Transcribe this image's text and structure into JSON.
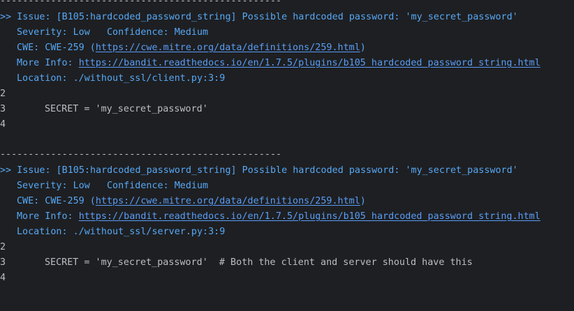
{
  "colors": {
    "background": "#1e1f22",
    "text": "#bcbec4",
    "accent": "#56a8f5",
    "link": "#589df6"
  },
  "blocks": [
    {
      "separator": "--------------------------------------------------",
      "issue_line": ">> Issue: [B105:hardcoded_password_string] Possible hardcoded password: 'my_secret_password'",
      "severity_line": "Severity: Low   Confidence: Medium",
      "cwe_prefix": "CWE: CWE-259 (",
      "cwe_url": "https://cwe.mitre.org/data/definitions/259.html",
      "cwe_suffix": ")",
      "more_info_prefix": "More Info: ",
      "more_info_url": "https://bandit.readthedocs.io/en/1.7.5/plugins/b105_hardcoded_password_string.html",
      "location_line": "Location: ./without_ssl/client.py:3:9",
      "code": [
        {
          "num": "2",
          "text": ""
        },
        {
          "num": "3",
          "text": "SECRET = 'my_secret_password'"
        },
        {
          "num": "4",
          "text": ""
        }
      ]
    },
    {
      "separator": "--------------------------------------------------",
      "issue_line": ">> Issue: [B105:hardcoded_password_string] Possible hardcoded password: 'my_secret_password'",
      "severity_line": "Severity: Low   Confidence: Medium",
      "cwe_prefix": "CWE: CWE-259 (",
      "cwe_url": "https://cwe.mitre.org/data/definitions/259.html",
      "cwe_suffix": ")",
      "more_info_prefix": "More Info: ",
      "more_info_url": "https://bandit.readthedocs.io/en/1.7.5/plugins/b105_hardcoded_password_string.html",
      "location_line": "Location: ./without_ssl/server.py:3:9",
      "code": [
        {
          "num": "2",
          "text": ""
        },
        {
          "num": "3",
          "text": "SECRET = 'my_secret_password'  # Both the client and server should have this"
        },
        {
          "num": "4",
          "text": ""
        }
      ]
    }
  ]
}
